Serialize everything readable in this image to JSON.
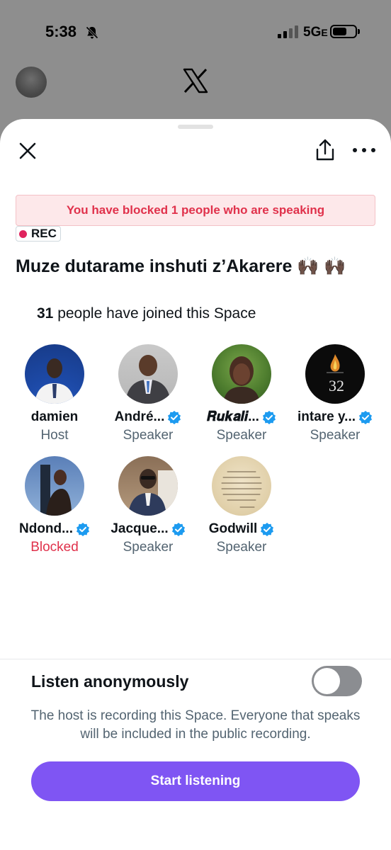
{
  "status_bar": {
    "time": "5:38",
    "network": "5G",
    "network_suffix": "E"
  },
  "sheet": {
    "blocked_banner": "You have blocked 1 people who are speaking",
    "rec_label": "REC",
    "title": "Muze dutarame inshuti z’Akarere 🙌🏿 🙌🏿",
    "joined_count": "31",
    "joined_text": " people have joined this Space"
  },
  "participants": [
    {
      "name": "damien",
      "role": "Host",
      "verified": false,
      "blocked": false
    },
    {
      "name": "André...",
      "role": "Speaker",
      "verified": true,
      "blocked": false
    },
    {
      "name": "𝑹𝒖𝒌𝒂𝒍𝒊...",
      "role": "Speaker",
      "verified": true,
      "blocked": false
    },
    {
      "name": "intare y...",
      "role": "Speaker",
      "verified": true,
      "blocked": false
    },
    {
      "name": "Ndond...",
      "role": "Blocked",
      "verified": true,
      "blocked": true
    },
    {
      "name": "Jacque...",
      "role": "Speaker",
      "verified": true,
      "blocked": false
    },
    {
      "name": "Godwill",
      "role": "Speaker",
      "verified": true,
      "blocked": false
    }
  ],
  "footer": {
    "listen_label": "Listen anonymously",
    "toggle_on": false,
    "recording_note": "The host is recording this Space. Everyone that speaks will be included in the public recording.",
    "start_button": "Start listening"
  },
  "colors": {
    "accent_purple": "#7f55f3",
    "blocked_red": "#e0314b",
    "verified_blue": "#1d9bf0",
    "rec_dot": "#e0245e"
  },
  "avatar_art": {
    "intare": "32"
  }
}
